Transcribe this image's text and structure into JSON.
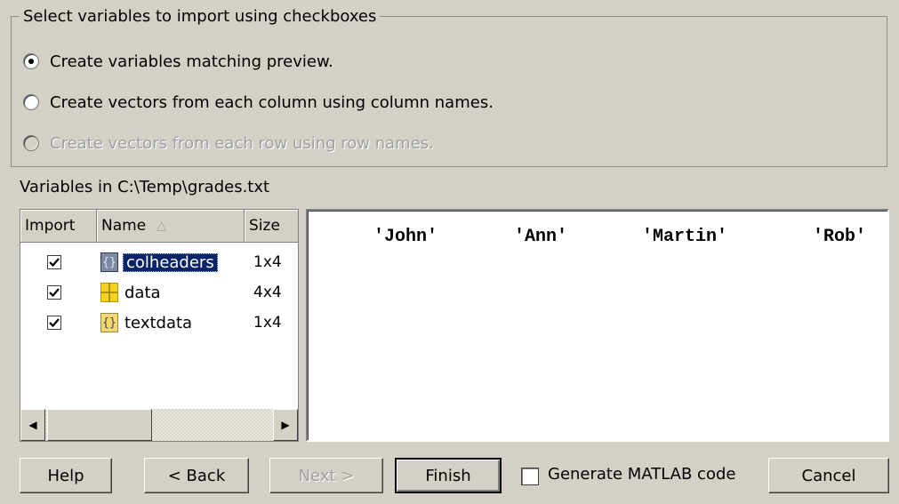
{
  "group": {
    "legend": "Select variables to import using checkboxes",
    "options": [
      {
        "label": "Create variables matching preview.",
        "checked": true,
        "disabled": false
      },
      {
        "label": "Create vectors from each column using column names.",
        "checked": false,
        "disabled": false
      },
      {
        "label": "Create vectors from each row using row names.",
        "checked": false,
        "disabled": true
      }
    ]
  },
  "variables_label": "Variables in C:\\Temp\\grades.txt",
  "list": {
    "headers": {
      "import": "Import",
      "name": "Name",
      "size": "Size"
    },
    "sort_indicator": "△",
    "rows": [
      {
        "checked": true,
        "icon": "cell-array-icon",
        "icon_glyph": "{}",
        "name": "colheaders",
        "size": "1x4",
        "selected": true
      },
      {
        "checked": true,
        "icon": "matrix-icon",
        "icon_glyph": "",
        "name": "data",
        "size": "4x4",
        "selected": false
      },
      {
        "checked": true,
        "icon": "cell-array-icon",
        "icon_glyph": "{}",
        "name": "textdata",
        "size": "1x4",
        "selected": false
      }
    ]
  },
  "preview": {
    "values": [
      "'John'",
      "'Ann'",
      "'Martin'",
      "'Rob'"
    ]
  },
  "buttons": {
    "help": "Help",
    "back": "< Back",
    "next": "Next >",
    "finish": "Finish",
    "generate_code": "Generate MATLAB code",
    "cancel": "Cancel"
  },
  "generate_code_checked": false
}
